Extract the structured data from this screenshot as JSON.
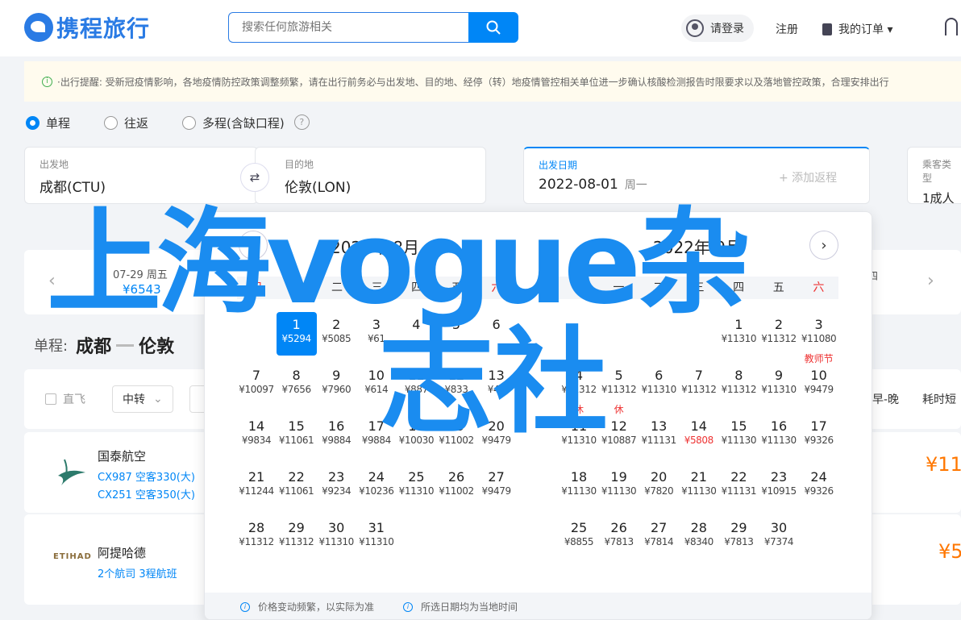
{
  "header": {
    "logo_text": "携程旅行",
    "search_placeholder": "搜索任何旅游相关",
    "login_label": "请登录",
    "register_label": "注册",
    "orders_label": "我的订单 ▾"
  },
  "notice": {
    "text": "·出行提醒: 受新冠疫情影响，各地疫情防控政策调整频繁，请在出行前务必与出发地、目的地、经停（转）地疫情管控相关单位进一步确认核酸检测报告时限要求以及落地管控政策，合理安排出行"
  },
  "trip_types": [
    {
      "label": "单程",
      "selected": true
    },
    {
      "label": "往返",
      "selected": false
    },
    {
      "label": "多程(含缺口程)",
      "selected": false
    }
  ],
  "search_form": {
    "from_label": "出发地",
    "from_value": "成都(CTU)",
    "to_label": "目的地",
    "to_value": "伦敦(LON)",
    "date_label": "出发日期",
    "date_value": "2022-08-01",
    "date_weekday": "周一",
    "add_return": "+ 添加返程",
    "passenger_label": "乘客类型",
    "passenger_value": "1成人"
  },
  "price_strip": {
    "day": "07-29  周五",
    "price": "¥6543",
    "next_day_partial": "四"
  },
  "route": {
    "prefix": "单程:",
    "from": "成都",
    "to": "伦敦"
  },
  "filters": {
    "direct": "直飞",
    "transfer": "中转",
    "sort_label": "早-晚",
    "duration_label": "耗时短"
  },
  "flights": [
    {
      "airline": "国泰航空",
      "numbers": [
        "CX987 空客330(大)",
        "CX251 空客350(大)"
      ],
      "price": "¥11",
      "logo": "cathay-logo"
    },
    {
      "airline": "阿提哈德",
      "numbers": [
        "2个航司  3程航班"
      ],
      "price": "¥5",
      "logo_text": "ETIHAD"
    }
  ],
  "calendar": {
    "left_title": "2022年 8月",
    "right_title": "2022年 9月",
    "weekdays": [
      "日",
      "一",
      "二",
      "三",
      "四",
      "五",
      "六"
    ],
    "footer_left": "价格变动频繁，以实际为准",
    "footer_right": "所选日期均为当地时间",
    "left_days": [
      {
        "d": "1",
        "p": "¥5294"
      },
      {
        "d": "2",
        "p": "¥5085"
      },
      {
        "d": "3",
        "p": "¥61"
      },
      {
        "d": "4",
        "p": ""
      },
      {
        "d": "5",
        "p": ""
      },
      {
        "d": "6",
        "p": ""
      },
      {
        "d": "7",
        "p": "¥10097"
      },
      {
        "d": "8",
        "p": "¥7656"
      },
      {
        "d": "9",
        "p": "¥7960"
      },
      {
        "d": "10",
        "p": "¥614"
      },
      {
        "d": "11",
        "p": "¥887"
      },
      {
        "d": "12",
        "p": "¥833"
      },
      {
        "d": "13",
        "p": "¥46"
      },
      {
        "d": "14",
        "p": "¥9834"
      },
      {
        "d": "15",
        "p": "¥11061"
      },
      {
        "d": "16",
        "p": "¥9884"
      },
      {
        "d": "17",
        "p": "¥9884"
      },
      {
        "d": "18",
        "p": "¥10030"
      },
      {
        "d": "19",
        "p": "¥11002"
      },
      {
        "d": "20",
        "p": "¥9479"
      },
      {
        "d": "21",
        "p": "¥11244"
      },
      {
        "d": "22",
        "p": "¥11061"
      },
      {
        "d": "23",
        "p": "¥9234"
      },
      {
        "d": "24",
        "p": "¥10236"
      },
      {
        "d": "25",
        "p": "¥11310"
      },
      {
        "d": "26",
        "p": "¥11002"
      },
      {
        "d": "27",
        "p": "¥9479"
      },
      {
        "d": "28",
        "p": "¥11312"
      },
      {
        "d": "29",
        "p": "¥11312"
      },
      {
        "d": "30",
        "p": "¥11310"
      },
      {
        "d": "31",
        "p": "¥11310"
      }
    ],
    "right_days": [
      {
        "d": "1",
        "p": "¥11310"
      },
      {
        "d": "2",
        "p": "¥11312"
      },
      {
        "d": "3",
        "p": "¥11080"
      },
      {
        "d": "4",
        "p": "¥11312"
      },
      {
        "d": "5",
        "p": "¥11312"
      },
      {
        "d": "6",
        "p": "¥11310"
      },
      {
        "d": "7",
        "p": "¥11312"
      },
      {
        "d": "8",
        "p": "¥11312"
      },
      {
        "d": "9",
        "p": "¥11310"
      },
      {
        "d": "10",
        "p": "¥9479",
        "tag": "教师节"
      },
      {
        "d": "11",
        "p": "¥11310",
        "tag": "休"
      },
      {
        "d": "12",
        "p": "¥10887",
        "tag": "休"
      },
      {
        "d": "13",
        "p": "¥11131"
      },
      {
        "d": "14",
        "p": "¥5808",
        "low": true
      },
      {
        "d": "15",
        "p": "¥11130"
      },
      {
        "d": "16",
        "p": "¥11130"
      },
      {
        "d": "17",
        "p": "¥9326"
      },
      {
        "d": "18",
        "p": "¥11130"
      },
      {
        "d": "19",
        "p": "¥11130"
      },
      {
        "d": "20",
        "p": "¥7820"
      },
      {
        "d": "21",
        "p": "¥11130"
      },
      {
        "d": "22",
        "p": "¥11131"
      },
      {
        "d": "23",
        "p": "¥10915"
      },
      {
        "d": "24",
        "p": "¥9326"
      },
      {
        "d": "25",
        "p": "¥8855"
      },
      {
        "d": "26",
        "p": "¥7813"
      },
      {
        "d": "27",
        "p": "¥7814"
      },
      {
        "d": "28",
        "p": "¥8340"
      },
      {
        "d": "29",
        "p": "¥7813"
      },
      {
        "d": "30",
        "p": "¥7374"
      }
    ]
  },
  "watermark": {
    "line1": "上海vogue杂",
    "line2": "志社"
  }
}
